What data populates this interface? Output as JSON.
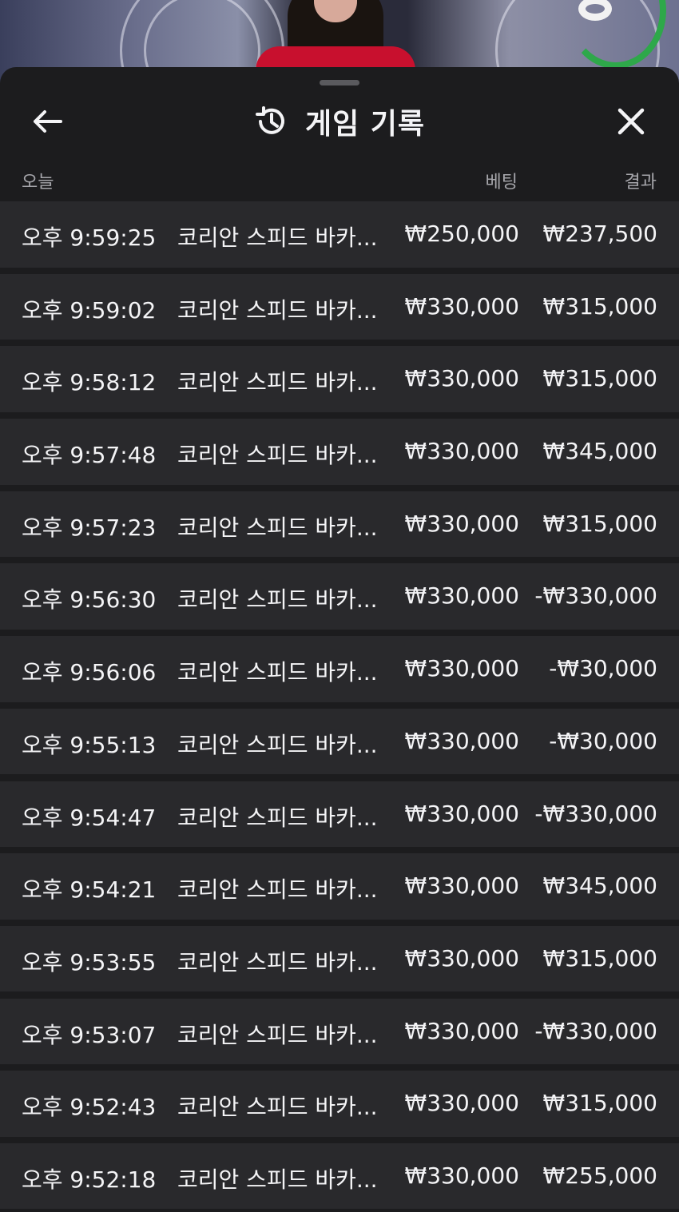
{
  "header": {
    "title": "게임 기록",
    "back_icon": "arrow-left-icon",
    "history_icon": "history-clock-icon",
    "close_icon": "close-icon"
  },
  "columns": {
    "today": "오늘",
    "bet": "베팅",
    "result": "결과"
  },
  "records": [
    {
      "time": "오후 9:59:25",
      "game": "코리안 스피드 바카...",
      "bet": "₩250,000",
      "result": "₩237,500"
    },
    {
      "time": "오후 9:59:02",
      "game": "코리안 스피드 바카...",
      "bet": "₩330,000",
      "result": "₩315,000"
    },
    {
      "time": "오후 9:58:12",
      "game": "코리안 스피드 바카...",
      "bet": "₩330,000",
      "result": "₩315,000"
    },
    {
      "time": "오후 9:57:48",
      "game": "코리안 스피드 바카...",
      "bet": "₩330,000",
      "result": "₩345,000"
    },
    {
      "time": "오후 9:57:23",
      "game": "코리안 스피드 바카...",
      "bet": "₩330,000",
      "result": "₩315,000"
    },
    {
      "time": "오후 9:56:30",
      "game": "코리안 스피드 바카...",
      "bet": "₩330,000",
      "result": "-₩330,000"
    },
    {
      "time": "오후 9:56:06",
      "game": "코리안 스피드 바카...",
      "bet": "₩330,000",
      "result": "-₩30,000"
    },
    {
      "time": "오후 9:55:13",
      "game": "코리안 스피드 바카...",
      "bet": "₩330,000",
      "result": "-₩30,000"
    },
    {
      "time": "오후 9:54:47",
      "game": "코리안 스피드 바카...",
      "bet": "₩330,000",
      "result": "-₩330,000"
    },
    {
      "time": "오후 9:54:21",
      "game": "코리안 스피드 바카...",
      "bet": "₩330,000",
      "result": "₩345,000"
    },
    {
      "time": "오후 9:53:55",
      "game": "코리안 스피드 바카...",
      "bet": "₩330,000",
      "result": "₩315,000"
    },
    {
      "time": "오후 9:53:07",
      "game": "코리안 스피드 바카...",
      "bet": "₩330,000",
      "result": "-₩330,000"
    },
    {
      "time": "오후 9:52:43",
      "game": "코리안 스피드 바카...",
      "bet": "₩330,000",
      "result": "₩315,000"
    },
    {
      "time": "오후 9:52:18",
      "game": "코리안 스피드 바카...",
      "bet": "₩330,000",
      "result": "₩255,000"
    }
  ]
}
